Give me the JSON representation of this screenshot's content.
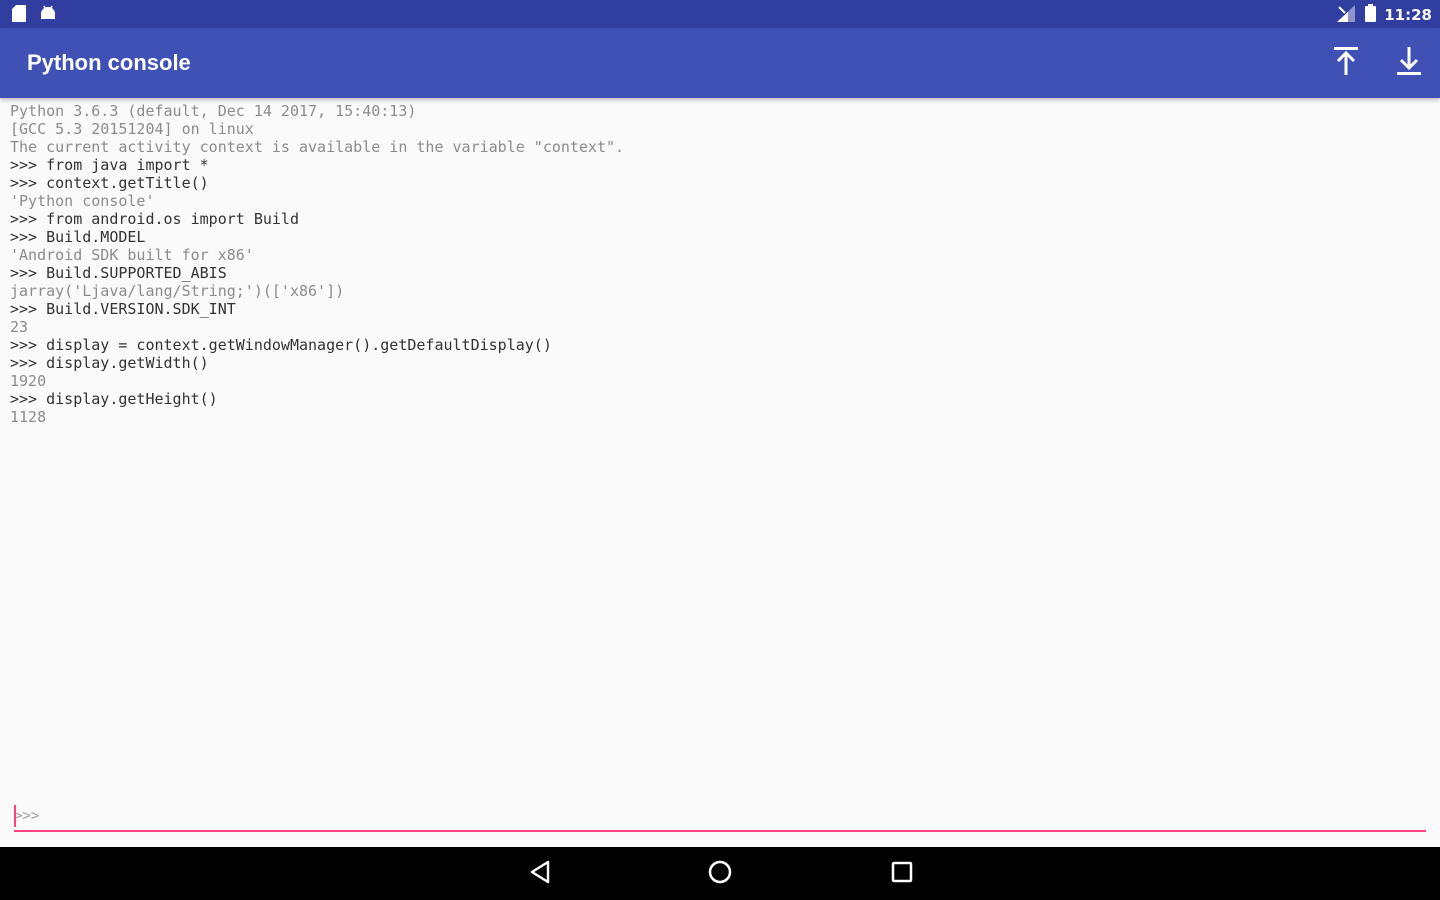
{
  "status_bar": {
    "time": "11:28",
    "left_icons": [
      "sd-card-icon",
      "android-icon"
    ],
    "right_icons": [
      "signal-icon",
      "battery-icon"
    ]
  },
  "app_bar": {
    "title": "Python console",
    "actions": [
      "scroll-to-top-icon",
      "scroll-to-bottom-icon"
    ]
  },
  "console": {
    "lines": [
      {
        "text": "Python 3.6.3 (default, Dec 14 2017, 15:40:13)",
        "kind": "output"
      },
      {
        "text": "[GCC 5.3 20151204] on linux",
        "kind": "output"
      },
      {
        "text": "The current activity context is available in the variable \"context\".",
        "kind": "output"
      },
      {
        "text": ">>> from java import *",
        "kind": "input"
      },
      {
        "text": ">>> context.getTitle()",
        "kind": "input"
      },
      {
        "text": "'Python console'",
        "kind": "output"
      },
      {
        "text": ">>> from android.os import Build",
        "kind": "input"
      },
      {
        "text": ">>> Build.MODEL",
        "kind": "input"
      },
      {
        "text": "'Android SDK built for x86'",
        "kind": "output"
      },
      {
        "text": ">>> Build.SUPPORTED_ABIS",
        "kind": "input"
      },
      {
        "text": "jarray('Ljava/lang/String;')(['x86'])",
        "kind": "output"
      },
      {
        "text": ">>> Build.VERSION.SDK_INT",
        "kind": "input"
      },
      {
        "text": "23",
        "kind": "output"
      },
      {
        "text": ">>> display = context.getWindowManager().getDefaultDisplay()",
        "kind": "input"
      },
      {
        "text": ">>> display.getWidth()",
        "kind": "input"
      },
      {
        "text": "1920",
        "kind": "output"
      },
      {
        "text": ">>> display.getHeight()",
        "kind": "input"
      },
      {
        "text": "1128",
        "kind": "output"
      }
    ]
  },
  "input": {
    "prompt": ">>>",
    "value": ""
  },
  "nav_bar": {
    "buttons": [
      "back-icon",
      "home-icon",
      "recents-icon"
    ]
  },
  "colors": {
    "status_bar": "#303f9f",
    "app_bar": "#3f51b5",
    "accent": "#ff4081",
    "background": "#fafafa",
    "nav_bar": "#000000"
  }
}
